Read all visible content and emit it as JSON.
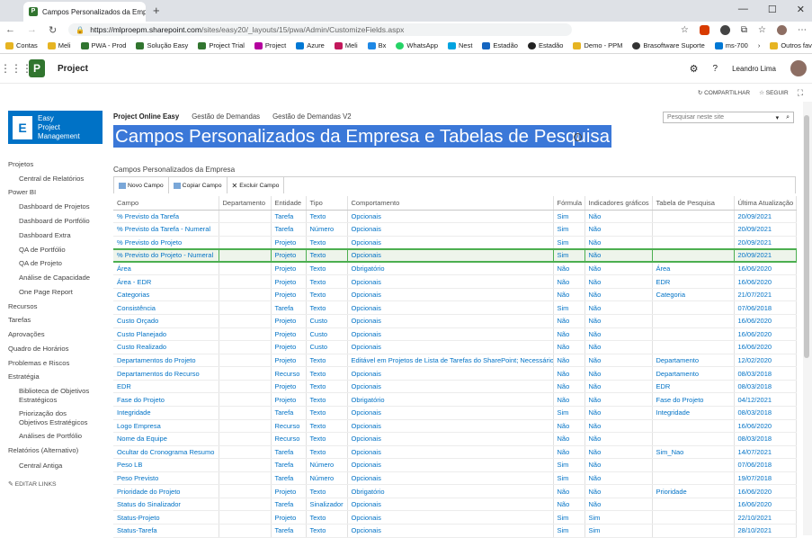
{
  "browser": {
    "tab_title": "Campos Personalizados da Empr",
    "url_prefix": "https://",
    "url_host": "mlproepm.sharepoint.com",
    "url_rest": "/sites/easy20/_layouts/15/pwa/Admin/CustomizeFields.aspx",
    "bookmarks": [
      "Contas",
      "Meli",
      "PWA - Prod",
      "Solução Easy",
      "Project Trial",
      "Project",
      "Azure",
      "Meli",
      "Bx",
      "WhatsApp",
      "Nest",
      "Estadão",
      "Estadão",
      "Demo - PPM",
      "Brasoftware Suporte",
      "ms-700",
      "Outros favoritos"
    ]
  },
  "suite": {
    "app_name": "Project",
    "user_name": "Leandro Lima"
  },
  "actions": {
    "share": "COMPARTILHAR",
    "follow": "SEGUIR"
  },
  "site": {
    "logo_line1": "Easy",
    "logo_line2": "Project",
    "logo_line3": "Management"
  },
  "topnav": [
    "Project Online Easy",
    "Gestão de Demandas",
    "Gestão de Demandas V2"
  ],
  "search": {
    "placeholder": "Pesquisar neste site"
  },
  "page": {
    "title": "Campos Personalizados da Empresa e Tabelas de Pesquisa",
    "subtitle": "Campos Personalizados da Empresa"
  },
  "leftnav": [
    {
      "label": "Projetos",
      "sub": false
    },
    {
      "label": "Central de Relatórios",
      "sub": true
    },
    {
      "label": "Power BI",
      "sub": false
    },
    {
      "label": "Dashboard de Projetos",
      "sub": true
    },
    {
      "label": "Dashboard de Portfólio",
      "sub": true
    },
    {
      "label": "Dashboard Extra",
      "sub": true
    },
    {
      "label": "QA de Portfólio",
      "sub": true
    },
    {
      "label": "QA de Projeto",
      "sub": true
    },
    {
      "label": "Análise de Capacidade",
      "sub": true
    },
    {
      "label": "One Page Report",
      "sub": true
    },
    {
      "label": "Recursos",
      "sub": false
    },
    {
      "label": "Tarefas",
      "sub": false
    },
    {
      "label": "Aprovações",
      "sub": false
    },
    {
      "label": "Quadro de Horários",
      "sub": false
    },
    {
      "label": "Problemas e Riscos",
      "sub": false
    },
    {
      "label": "Estratégia",
      "sub": false
    },
    {
      "label": "Biblioteca de Objetivos",
      "label2": "Estratégicos",
      "sub": true
    },
    {
      "label": "Priorização dos",
      "label2": "Objetivos Estratégicos",
      "sub": true
    },
    {
      "label": "Análises de Portfólio",
      "sub": true
    },
    {
      "label": "Relatórios (Alternativo)",
      "sub": false
    },
    {
      "label": "Central Antiga",
      "sub": true
    },
    {
      "label": "EDITAR LINKS",
      "sub": false
    }
  ],
  "toolbar": {
    "new_field": "Novo Campo",
    "copy_field": "Copiar Campo",
    "delete_field": "Excluir Campo"
  },
  "columns": [
    "Campo",
    "Departamento",
    "Entidade",
    "Tipo",
    "Comportamento",
    "Fórmula",
    "Indicadores gráficos",
    "Tabela de Pesquisa",
    "Última Atualização"
  ],
  "rows": [
    [
      "% Previsto da Tarefa",
      "",
      "Tarefa",
      "Texto",
      "Opcionais",
      "Sim",
      "Não",
      "",
      "20/09/2021"
    ],
    [
      "% Previsto da Tarefa - Numeral",
      "",
      "Tarefa",
      "Número",
      "Opcionais",
      "Sim",
      "Não",
      "",
      "20/09/2021"
    ],
    [
      "% Previsto do Projeto",
      "",
      "Projeto",
      "Texto",
      "Opcionais",
      "Sim",
      "Não",
      "",
      "20/09/2021"
    ],
    [
      "% Previsto do Projeto - Numeral",
      "",
      "Projeto",
      "Texto",
      "Opcionais",
      "Sim",
      "Não",
      "",
      "20/09/2021"
    ],
    [
      "Área",
      "",
      "Projeto",
      "Texto",
      "Obrigatório",
      "Não",
      "Não",
      "Área",
      "16/06/2020"
    ],
    [
      "Área - EDR",
      "",
      "Projeto",
      "Texto",
      "Opcionais",
      "Não",
      "Não",
      "EDR",
      "16/06/2020"
    ],
    [
      "Categorias",
      "",
      "Projeto",
      "Texto",
      "Opcionais",
      "Não",
      "Não",
      "Categoria",
      "21/07/2021"
    ],
    [
      "Consistência",
      "",
      "Tarefa",
      "Texto",
      "Opcionais",
      "Sim",
      "Não",
      "",
      "07/06/2018"
    ],
    [
      "Custo Orçado",
      "",
      "Projeto",
      "Custo",
      "Opcionais",
      "Não",
      "Não",
      "",
      "16/06/2020"
    ],
    [
      "Custo Planejado",
      "",
      "Projeto",
      "Custo",
      "Opcionais",
      "Não",
      "Não",
      "",
      "16/06/2020"
    ],
    [
      "Custo Realizado",
      "",
      "Projeto",
      "Custo",
      "Opcionais",
      "Não",
      "Não",
      "",
      "16/06/2020"
    ],
    [
      "Departamentos do Projeto",
      "",
      "Projeto",
      "Texto",
      "Editável em Projetos de Lista de Tarefas do SharePoint; Necessário",
      "Não",
      "Não",
      "Departamento",
      "12/02/2020"
    ],
    [
      "Departamentos do Recurso",
      "",
      "Recurso",
      "Texto",
      "Opcionais",
      "Não",
      "Não",
      "Departamento",
      "08/03/2018"
    ],
    [
      "EDR",
      "",
      "Projeto",
      "Texto",
      "Opcionais",
      "Não",
      "Não",
      "EDR",
      "08/03/2018"
    ],
    [
      "Fase do Projeto",
      "",
      "Projeto",
      "Texto",
      "Obrigatório",
      "Não",
      "Não",
      "Fase do Projeto",
      "04/12/2021"
    ],
    [
      "Integridade",
      "",
      "Tarefa",
      "Texto",
      "Opcionais",
      "Sim",
      "Não",
      "Integridade",
      "08/03/2018"
    ],
    [
      "Logo Empresa",
      "",
      "Recurso",
      "Texto",
      "Opcionais",
      "Não",
      "Não",
      "",
      "16/06/2020"
    ],
    [
      "Nome da Equipe",
      "",
      "Recurso",
      "Texto",
      "Opcionais",
      "Não",
      "Não",
      "",
      "08/03/2018"
    ],
    [
      "Ocultar do Cronograma Resumo",
      "",
      "Tarefa",
      "Texto",
      "Opcionais",
      "Não",
      "Não",
      "Sim_Nao",
      "14/07/2021"
    ],
    [
      "Peso LB",
      "",
      "Tarefa",
      "Número",
      "Opcionais",
      "Sim",
      "Não",
      "",
      "07/06/2018"
    ],
    [
      "Peso Previsto",
      "",
      "Tarefa",
      "Número",
      "Opcionais",
      "Sim",
      "Não",
      "",
      "19/07/2018"
    ],
    [
      "Prioridade do Projeto",
      "",
      "Projeto",
      "Texto",
      "Obrigatório",
      "Não",
      "Não",
      "Prioridade",
      "16/06/2020"
    ],
    [
      "Status do Sinalizador",
      "",
      "Tarefa",
      "Sinalizador",
      "Opcionais",
      "Não",
      "Não",
      "",
      "16/06/2020"
    ],
    [
      "Status-Projeto",
      "",
      "Projeto",
      "Texto",
      "Opcionais",
      "Sim",
      "Sim",
      "",
      "22/10/2021"
    ],
    [
      "Status-Tarefa",
      "",
      "Tarefa",
      "Texto",
      "Opcionais",
      "Sim",
      "Sim",
      "",
      "28/10/2021"
    ]
  ],
  "selected_row": 3,
  "colors": {
    "accent": "#0072c6",
    "selection": "#4caf50",
    "title_highlight": "#3b78d8",
    "project_green": "#31752f"
  }
}
